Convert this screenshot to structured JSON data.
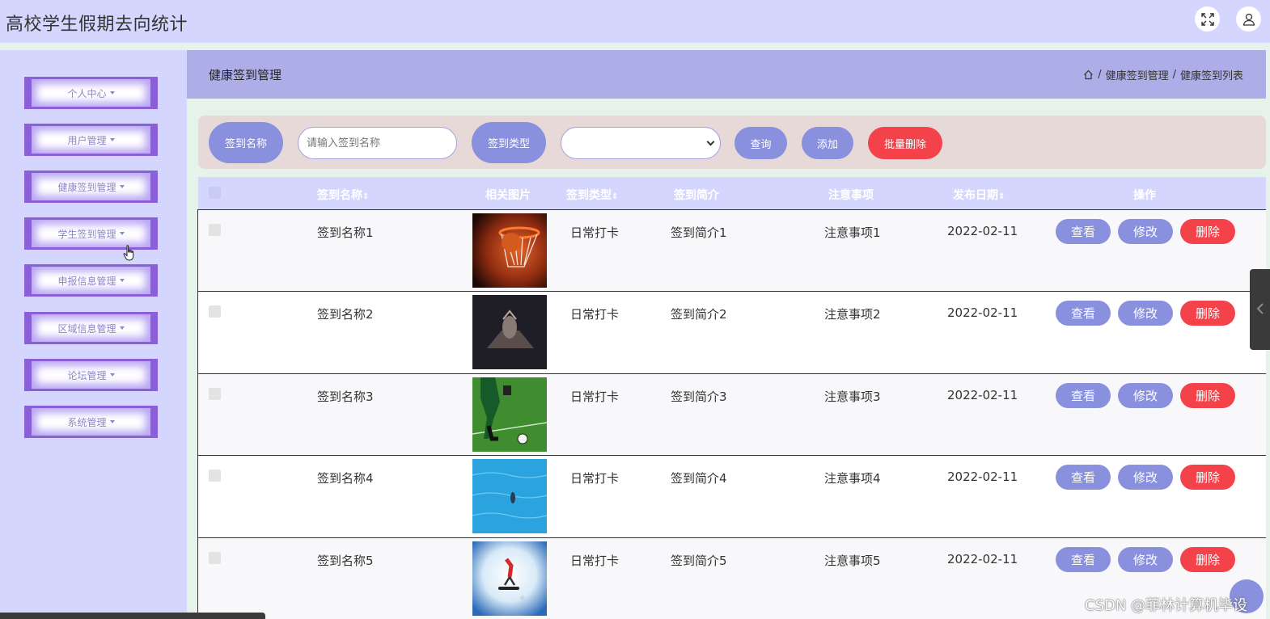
{
  "app": {
    "title": "高校学生假期去向统计"
  },
  "header_icons": {
    "fullscreen": "fullscreen-icon",
    "user": "user-icon"
  },
  "sidebar": {
    "items": [
      {
        "label": "个人中心"
      },
      {
        "label": "用户管理"
      },
      {
        "label": "健康签到管理"
      },
      {
        "label": "学生签到管理"
      },
      {
        "label": "申报信息管理"
      },
      {
        "label": "区域信息管理"
      },
      {
        "label": "论坛管理"
      },
      {
        "label": "系统管理"
      }
    ]
  },
  "page": {
    "title": "健康签到管理",
    "breadcrumb": {
      "sep": "/",
      "level1": "健康签到管理",
      "level2": "健康签到列表"
    }
  },
  "filter": {
    "name_label": "签到名称",
    "name_placeholder": "请输入签到名称",
    "type_label": "签到类型",
    "type_value": "",
    "query_label": "查询",
    "add_label": "添加",
    "batch_delete_label": "批量删除"
  },
  "table": {
    "headers": {
      "name": "签到名称",
      "image": "相关图片",
      "type": "签到类型",
      "intro": "签到简介",
      "notes": "注意事项",
      "date": "发布日期",
      "actions": "操作",
      "sort_glyph": "⇕"
    },
    "rows": [
      {
        "name": "签到名称1",
        "type": "日常打卡",
        "intro": "签到简介1",
        "notes": "注意事项1",
        "date": "2022-02-11"
      },
      {
        "name": "签到名称2",
        "type": "日常打卡",
        "intro": "签到简介2",
        "notes": "注意事项2",
        "date": "2022-02-11"
      },
      {
        "name": "签到名称3",
        "type": "日常打卡",
        "intro": "签到简介3",
        "notes": "注意事项3",
        "date": "2022-02-11"
      },
      {
        "name": "签到名称4",
        "type": "日常打卡",
        "intro": "签到简介4",
        "notes": "注意事项4",
        "date": "2022-02-11"
      },
      {
        "name": "签到名称5",
        "type": "日常打卡",
        "intro": "签到简介5",
        "notes": "注意事项5",
        "date": "2022-02-11"
      }
    ],
    "row_actions": {
      "view": "查看",
      "edit": "修改",
      "delete": "删除"
    }
  },
  "watermark": "CSDN @菲林计算机毕设",
  "colors": {
    "header_bg": "#d4d6fd",
    "menu_border": "#8b5fd8",
    "page_header_bg": "#adaee8",
    "pill": "#8990dd",
    "danger": "#f4424a"
  }
}
